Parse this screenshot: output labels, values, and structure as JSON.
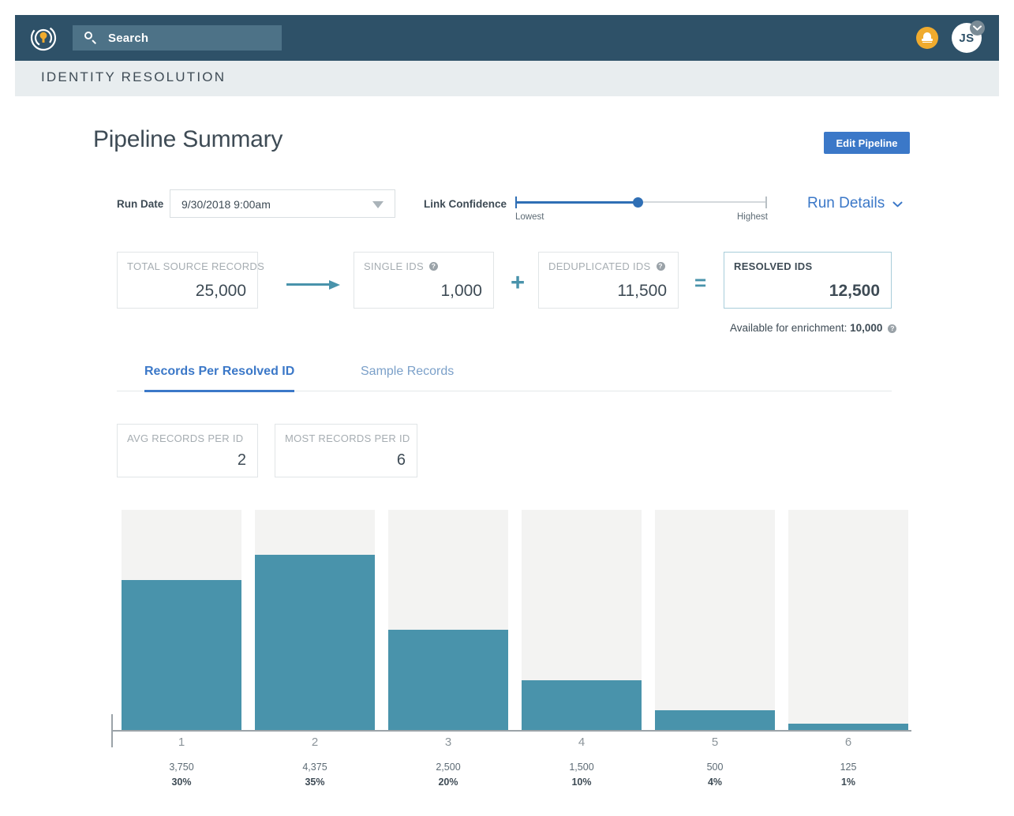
{
  "topbar": {
    "logo_name": "identity-logo",
    "search_placeholder": "Search",
    "notifications_label": "",
    "avatar_initials": "JS"
  },
  "band": {
    "title": "IDENTITY RESOLUTION"
  },
  "header": {
    "page_title": "Pipeline Summary",
    "edit_button": "Edit Pipeline"
  },
  "controls": {
    "run_date_label": "Run Date",
    "run_date_value": "9/30/2018 9:00am",
    "link_confidence_label": "Link Confidence",
    "slider_min_label": "Lowest",
    "slider_max_label": "Highest",
    "slider_value_percent": 49,
    "run_details_label": "Run Details"
  },
  "pipeline": {
    "cards": [
      {
        "label": "TOTAL SOURCE RECORDS",
        "value": "25,000",
        "help": false
      },
      {
        "label": "SINGLE IDS",
        "value": "1,000",
        "help": true
      },
      {
        "label": "DEDUPLICATED IDS",
        "value": "11,500",
        "help": true
      },
      {
        "label": "RESOLVED IDS",
        "value": "12,500",
        "help": false
      }
    ],
    "operator_plus": "+",
    "operator_equals": "=",
    "enrichment_prefix": "Available for enrichment: ",
    "enrichment_value": "10,000"
  },
  "tabs": [
    {
      "label": "Records Per Resolved ID",
      "active": true
    },
    {
      "label": "Sample Records",
      "active": false
    }
  ],
  "record_stats": [
    {
      "label": "AVG RECORDS PER ID",
      "value": "2"
    },
    {
      "label": "MOST RECORDS PER ID",
      "value": "6"
    }
  ],
  "chart_data": {
    "type": "bar",
    "title": "Records Per Resolved ID",
    "xlabel": "",
    "ylabel": "",
    "grid": false,
    "legend": "none",
    "categories": [
      "1",
      "2",
      "3",
      "4",
      "5",
      "6"
    ],
    "values": [
      3750,
      4375,
      2500,
      1500,
      500,
      125
    ],
    "value_labels": [
      "3,750",
      "4,375",
      "2,500",
      "1,500",
      "500",
      "125"
    ],
    "percent_labels": [
      "30%",
      "35%",
      "20%",
      "10%",
      "4%",
      "1%"
    ],
    "percents": [
      30,
      35,
      20,
      10,
      4,
      1
    ],
    "ylim": [
      0,
      12500
    ],
    "bar_color": "#4993ab",
    "track_color": "#f3f3f2"
  }
}
